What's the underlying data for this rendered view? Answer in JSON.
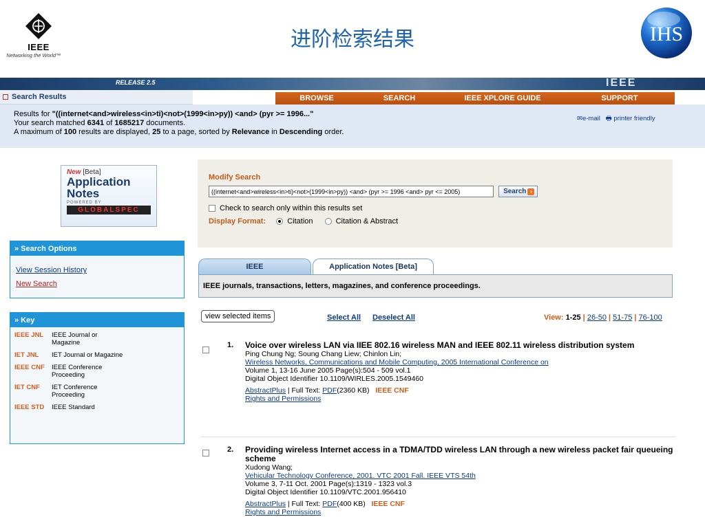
{
  "header": {
    "org_word": "IEEE",
    "org_tagline": "Networking the World™",
    "slide_title": "进阶检索结果",
    "brand_logo_text": "IHS"
  },
  "banner": {
    "release": "RELEASE 2.5",
    "wordmark": "IEEE"
  },
  "nav": {
    "section_title": "Search Results",
    "items": [
      "BROWSE",
      "SEARCH",
      "IEEE XPLORE GUIDE",
      "SUPPORT"
    ]
  },
  "results_info": {
    "line1_prefix": "Results for ",
    "query": "\"((internet<and>wireless<in>ti)<not>(1999<in>py)) <and> (pyr >= 1996...\"",
    "line2_prefix": "Your search matched ",
    "matched": "6341",
    "of": " of ",
    "total": "1685217",
    "line2_suffix": " documents.",
    "line3_prefix": "A maximum of ",
    "max": "100",
    "line3_mid": " results are displayed, ",
    "per_page": "25",
    "line3_mid2": " to a page, sorted by ",
    "sort": "Relevance",
    "line3_mid3": " in ",
    "order": "Descending",
    "line3_suffix": " order.",
    "email_label": "e-mail",
    "printer_label": "printer friendly"
  },
  "appnotes_promo": {
    "new": "New",
    "beta": " [Beta]",
    "line1": "Application",
    "line2": "Notes",
    "powered": "POWERED BY",
    "partner": "GLOBALSPEC"
  },
  "search_options": {
    "title": "» Search Options",
    "links": [
      "View Session History",
      "New Search"
    ]
  },
  "key": {
    "title": "» Key",
    "rows": [
      {
        "code": "IEEE JNL",
        "desc": "IEEE Journal or Magazine"
      },
      {
        "code": "IET JNL",
        "desc": "IET Journal or Magazine"
      },
      {
        "code": "IEEE CNF",
        "desc": "IEEE Conference Proceeding"
      },
      {
        "code": "IET CNF",
        "desc": "IET Conference Proceeding"
      },
      {
        "code": "IEEE STD",
        "desc": "IEEE Standard"
      }
    ]
  },
  "modify": {
    "title": "Modify Search",
    "query_value": "((internet<and>wireless<in>ti)<not>(1999<in>py)) <and> (pyr >= 1996 <and> pyr <= 2005)",
    "search_label": "Search",
    "within_label": "Check to search only within this results set",
    "format_label": "Display Format:",
    "format_options": [
      "Citation",
      "Citation & Abstract"
    ],
    "format_selected": "Citation"
  },
  "tabs": {
    "ieee": "IEEE",
    "appnotes": "Application Notes [Beta]",
    "description": "IEEE journals, transactions, letters, magazines, and conference proceedings."
  },
  "controls": {
    "view_selected": "view selected items",
    "select_all": "Select All",
    "deselect_all": "Deselect All",
    "view_label": "View: ",
    "view_current": "1-25",
    "pages": [
      "26-50",
      "51-75",
      "76-100"
    ]
  },
  "results": [
    {
      "num": "1.",
      "title": "Voice over wireless LAN via IIEE 802.16 wireless MAN and IEEE 802.11 wireless distribution system",
      "authors": "Ping Chung Ng; Soung Chang Liew; Chinlon Lin;",
      "venue": "Wireless Networks, Communications and Mobile Computing, 2005 International Conference on",
      "volume": "Volume 1,  13-16 June 2005 Page(s):504 - 509 vol.1",
      "doi": "Digital Object Identifier 10.1109/WIRLES.2005.1549460",
      "abstract_link": "AbstractPlus",
      "fulltext_label": " | Full Text: ",
      "pdf_link": "PDF",
      "pdf_size": "(2360 KB)",
      "type": "IEEE CNF",
      "rights": "Rights and Permissions"
    },
    {
      "num": "2.",
      "title": "Providing wireless Internet access in a TDMA/TDD wireless LAN through a new wireless packet fair queueing scheme",
      "authors": "Xudong Wang;",
      "venue": "Vehicular Technology Conference, 2001. VTC 2001 Fall. IEEE VTS 54th",
      "volume": "Volume 3,  7-11 Oct. 2001 Page(s):1319 - 1323 vol.3",
      "doi": "Digital Object Identifier 10.1109/VTC.2001.956410",
      "abstract_link": "AbstractPlus",
      "fulltext_label": " | Full Text: ",
      "pdf_link": "PDF",
      "pdf_size": "(400 KB)",
      "type": "IEEE CNF",
      "rights": "Rights and Permissions"
    }
  ]
}
